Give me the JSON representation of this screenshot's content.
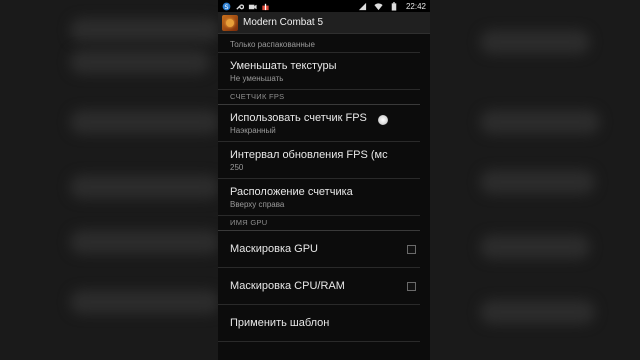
{
  "statusbar": {
    "time": "22:42",
    "left_icons": [
      "skype-icon",
      "wrench-icon",
      "camera-icon",
      "gift-icon"
    ],
    "right_icons": [
      "signal-icon",
      "wifi-icon",
      "battery-icon"
    ]
  },
  "actionbar": {
    "title": "Modern Combat 5"
  },
  "list": {
    "top_partial_sub": "Только распакованные",
    "reduce_textures": {
      "title": "Уменьшать текстуры",
      "sub": "Не уменьшать"
    },
    "fps_section": "СЧЕТЧИК FPS",
    "use_fps": {
      "title": "Использовать счетчик FPS",
      "sub": "Наэкранный"
    },
    "fps_interval": {
      "title": "Интервал обновления FPS (мс",
      "sub": "250"
    },
    "counter_position": {
      "title": "Расположение счетчика",
      "sub": "Вверху справа"
    },
    "gpu_section": "ИМЯ GPU",
    "mask_gpu": {
      "title": "Маскировка GPU",
      "checked": false
    },
    "mask_cpu": {
      "title": "Маскировка CPU/RAM",
      "checked": false
    },
    "apply_template": {
      "title": "Применить шаблон"
    }
  }
}
